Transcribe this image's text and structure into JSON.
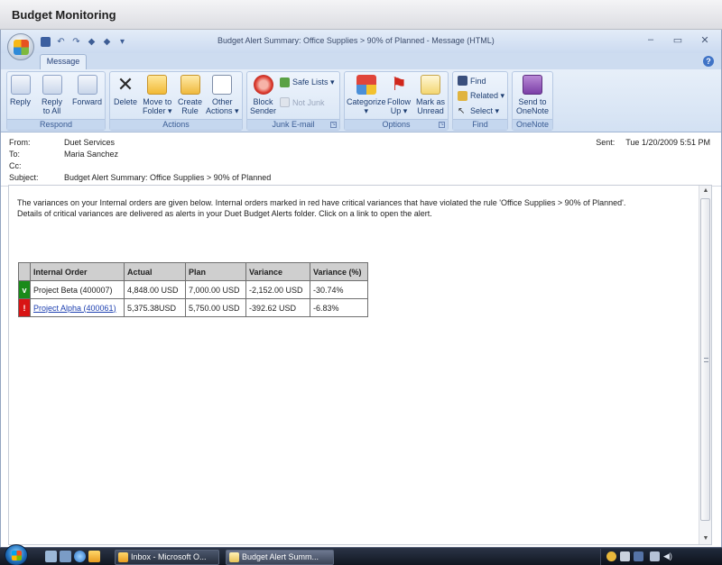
{
  "banner": {
    "title": "Budget Monitoring"
  },
  "window": {
    "title": "Budget Alert Summary: Office Supplies  > 90% of Planned  -  Message (HTML)",
    "controls": {
      "minimize": "–",
      "maximize": "▭",
      "close": "✕"
    }
  },
  "ribbon": {
    "tab": "Message",
    "groups": {
      "respond": {
        "label": "Respond",
        "reply": [
          "Reply",
          ""
        ],
        "reply_all": [
          "Reply",
          "to All"
        ],
        "forward": [
          "Forward",
          ""
        ]
      },
      "actions": {
        "label": "Actions",
        "delete": [
          "Delete",
          ""
        ],
        "move": [
          "Move to",
          "Folder ▾"
        ],
        "create_rule": [
          "Create",
          "Rule"
        ],
        "other": [
          "Other",
          "Actions ▾"
        ]
      },
      "junk": {
        "label": "Junk E-mail",
        "block": [
          "Block",
          "Sender"
        ],
        "safe_lists": "Safe Lists ▾",
        "not_junk": "Not Junk"
      },
      "options": {
        "label": "Options",
        "categorize": [
          "Categorize",
          "▾"
        ],
        "follow_up": [
          "Follow",
          "Up ▾"
        ],
        "mark_unread": [
          "Mark as",
          "Unread"
        ]
      },
      "find": {
        "label": "Find",
        "find": "Find",
        "related": "Related ▾",
        "select": "Select ▾"
      },
      "onenote": {
        "label": "OneNote",
        "send": [
          "Send to",
          "OneNote"
        ]
      }
    }
  },
  "header": {
    "from_label": "From:",
    "from": "Duet Services",
    "to_label": "To:",
    "to": "Maria Sanchez",
    "cc_label": "Cc:",
    "cc": "",
    "subject_label": "Subject:",
    "subject": "Budget Alert Summary: Office Supplies  > 90% of Planned",
    "sent_label": "Sent:",
    "sent": "Tue 1/20/2009 5:51 PM"
  },
  "body": {
    "text_line1": "The variances on your Internal orders are given below. Internal orders marked in red have critical variances that have violated the rule 'Office Supplies > 90% of Planned'.",
    "text_line2": "Details of critical variances are delivered as alerts in your Duet Budget Alerts folder. Click on a link to open the alert.",
    "table": {
      "headers": [
        "Internal Order",
        "Actual",
        "Plan",
        "Variance",
        "Variance (%)"
      ],
      "rows": [
        {
          "flag": "v",
          "flag_color": "#1a8a1a",
          "order": "Project Beta (400007)",
          "link": false,
          "actual": "4,848.00 USD",
          "plan": "7,000.00 USD",
          "variance": "-2,152.00 USD",
          "variance_pct": "-30.74%"
        },
        {
          "flag": "!",
          "flag_color": "#d81414",
          "order": "Project Alpha (400061)",
          "link": true,
          "actual": "5,375.38USD",
          "plan": "5,750.00 USD",
          "variance": "-392.62 USD",
          "variance_pct": "-6.83%"
        }
      ]
    }
  },
  "taskbar": {
    "buttons": [
      {
        "label": "Inbox - Microsoft O..."
      },
      {
        "label": "Budget Alert Summ..."
      }
    ]
  }
}
